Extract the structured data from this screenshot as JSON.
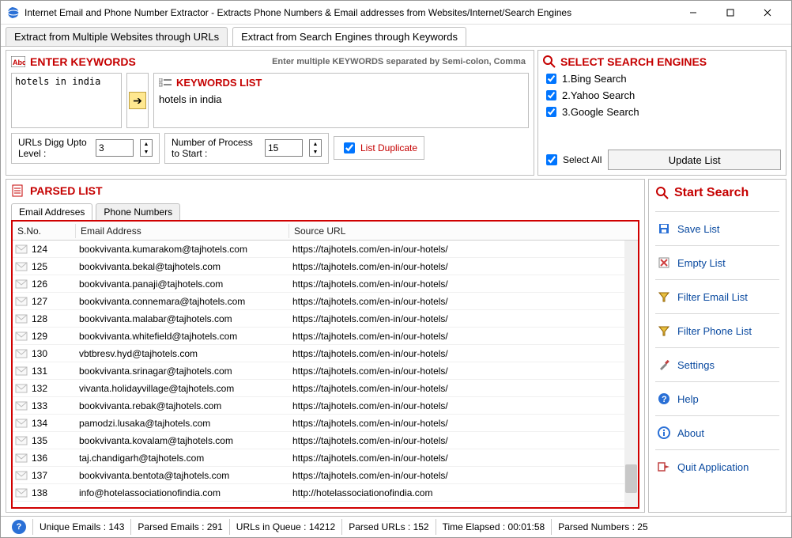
{
  "title": "Internet Email and Phone Number Extractor - Extracts Phone Numbers & Email addresses from Websites/Internet/Search Engines",
  "main_tabs": {
    "a": "Extract from Multiple Websites through URLs",
    "b": "Extract from Search Engines through Keywords"
  },
  "keywords": {
    "title": "ENTER KEYWORDS",
    "hint": "Enter multiple KEYWORDS separated by Semi-colon, Comma",
    "input": "hotels in india",
    "list_title": "KEYWORDS LIST",
    "list": [
      "hotels in india"
    ]
  },
  "cfg": {
    "digg_label": "URLs Digg Upto Level :",
    "digg_value": "3",
    "proc_label": "Number of Process to Start :",
    "proc_value": "15",
    "list_dup": "List Duplicate"
  },
  "se": {
    "title": "SELECT SEARCH ENGINES",
    "engines": [
      "1.Bing Search",
      "2.Yahoo Search",
      "3.Google Search"
    ],
    "select_all": "Select All",
    "update": "Update List"
  },
  "parsed": {
    "title": "PARSED LIST",
    "tabs": {
      "a": "Email Addreses",
      "b": "Phone Numbers"
    },
    "cols": {
      "sno": "S.No.",
      "email": "Email Address",
      "src": "Source URL"
    },
    "rows": [
      {
        "n": "124",
        "e": "bookvivanta.kumarakom@tajhotels.com",
        "s": "https://tajhotels.com/en-in/our-hotels/"
      },
      {
        "n": "125",
        "e": "bookvivanta.bekal@tajhotels.com",
        "s": "https://tajhotels.com/en-in/our-hotels/"
      },
      {
        "n": "126",
        "e": "bookvivanta.panaji@tajhotels.com",
        "s": "https://tajhotels.com/en-in/our-hotels/"
      },
      {
        "n": "127",
        "e": "bookvivanta.connemara@tajhotels.com",
        "s": "https://tajhotels.com/en-in/our-hotels/"
      },
      {
        "n": "128",
        "e": "bookvivanta.malabar@tajhotels.com",
        "s": "https://tajhotels.com/en-in/our-hotels/"
      },
      {
        "n": "129",
        "e": "bookvivanta.whitefield@tajhotels.com",
        "s": "https://tajhotels.com/en-in/our-hotels/"
      },
      {
        "n": "130",
        "e": "vbtbresv.hyd@tajhotels.com",
        "s": "https://tajhotels.com/en-in/our-hotels/"
      },
      {
        "n": "131",
        "e": "bookvivanta.srinagar@tajhotels.com",
        "s": "https://tajhotels.com/en-in/our-hotels/"
      },
      {
        "n": "132",
        "e": "vivanta.holidayvillage@tajhotels.com",
        "s": "https://tajhotels.com/en-in/our-hotels/"
      },
      {
        "n": "133",
        "e": "bookvivanta.rebak@tajhotels.com",
        "s": "https://tajhotels.com/en-in/our-hotels/"
      },
      {
        "n": "134",
        "e": "pamodzi.lusaka@tajhotels.com",
        "s": "https://tajhotels.com/en-in/our-hotels/"
      },
      {
        "n": "135",
        "e": "bookvivanta.kovalam@tajhotels.com",
        "s": "https://tajhotels.com/en-in/our-hotels/"
      },
      {
        "n": "136",
        "e": "taj.chandigarh@tajhotels.com",
        "s": "https://tajhotels.com/en-in/our-hotels/"
      },
      {
        "n": "137",
        "e": "bookvivanta.bentota@tajhotels.com",
        "s": "https://tajhotels.com/en-in/our-hotels/"
      },
      {
        "n": "138",
        "e": "info@hotelassociationofindia.com",
        "s": "http://hotelassociationofindia.com"
      }
    ]
  },
  "actions": {
    "start": "Start Search",
    "save": "Save List",
    "empty": "Empty List",
    "filter_email": "Filter Email List",
    "filter_phone": "Filter Phone List",
    "settings": "Settings",
    "help": "Help",
    "about": "About",
    "quit": "Quit Application"
  },
  "status": {
    "unique": "Unique Emails :  143",
    "parsed": "Parsed Emails :   291",
    "queue": "URLs in Queue :  14212",
    "purls": "Parsed URLs :   152",
    "time": "Time Elapsed :   00:01:58",
    "pnums": "Parsed Numbers :   25"
  }
}
